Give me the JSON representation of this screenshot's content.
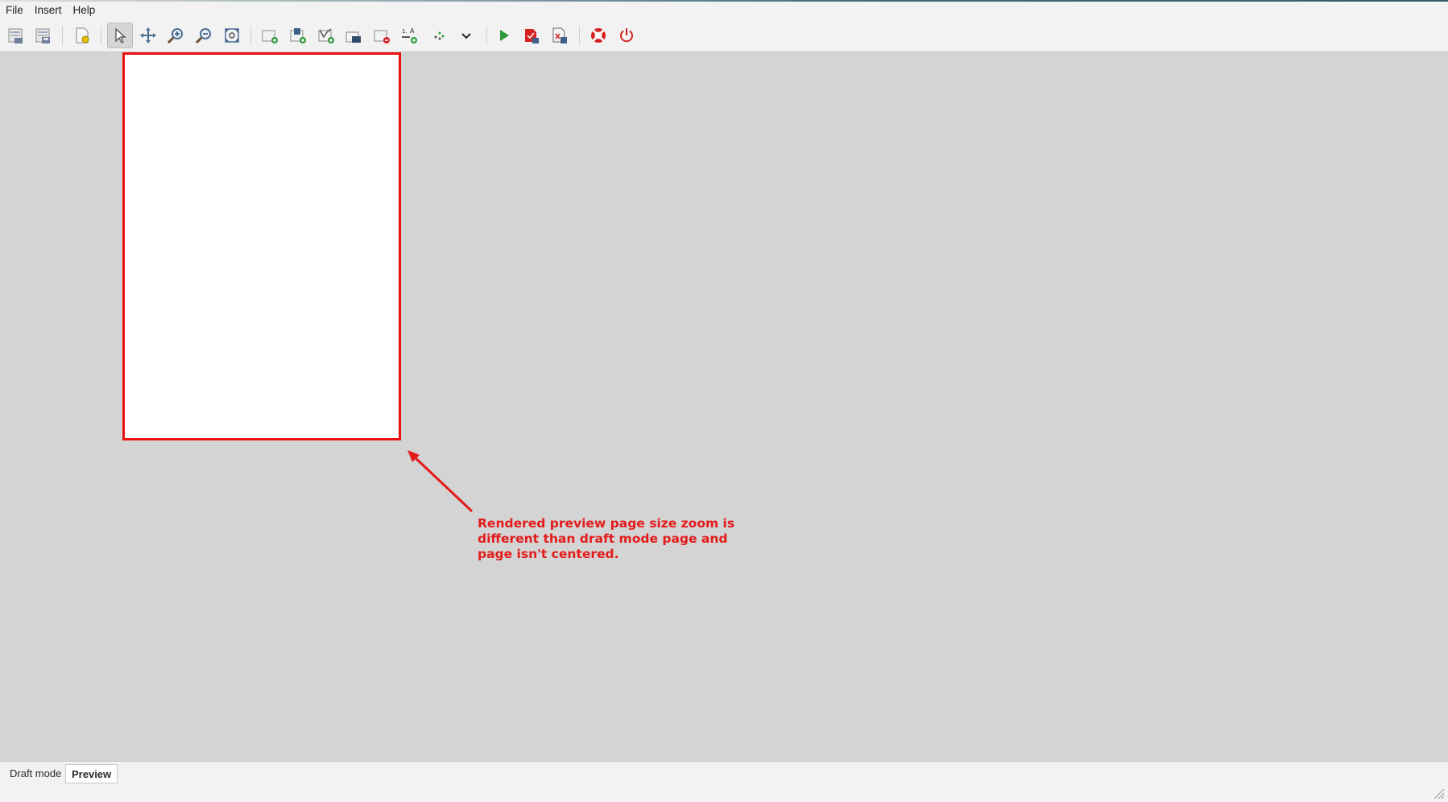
{
  "menu": {
    "file": "File",
    "insert": "Insert",
    "help": "Help"
  },
  "toolbar": {
    "icons": [
      "new-report-icon",
      "open-report-icon",
      "page-settings-icon",
      "select-pointer-icon",
      "pan-icon",
      "zoom-in-icon",
      "zoom-out-icon",
      "zoom-fit-icon",
      "add-page-icon",
      "add-image-icon",
      "add-chart-icon",
      "add-shape-icon",
      "delete-element-icon",
      "add-text-field-icon",
      "align-icon",
      "dropdown-chevron-icon",
      "run-icon",
      "export-pdf-icon",
      "export-document-icon",
      "help-lifebuoy-icon",
      "power-icon"
    ]
  },
  "annotation": {
    "text": "Rendered preview page size zoom is\ndifferent than draft mode page and\npage isn't centered.",
    "color": "#e31b1b"
  },
  "tabs": {
    "draft": "Draft mode",
    "preview": "Preview"
  },
  "colors": {
    "highlight_red": "#ee1111",
    "canvas_bg": "#d4d4d4",
    "run_green": "#2e9a3a"
  }
}
